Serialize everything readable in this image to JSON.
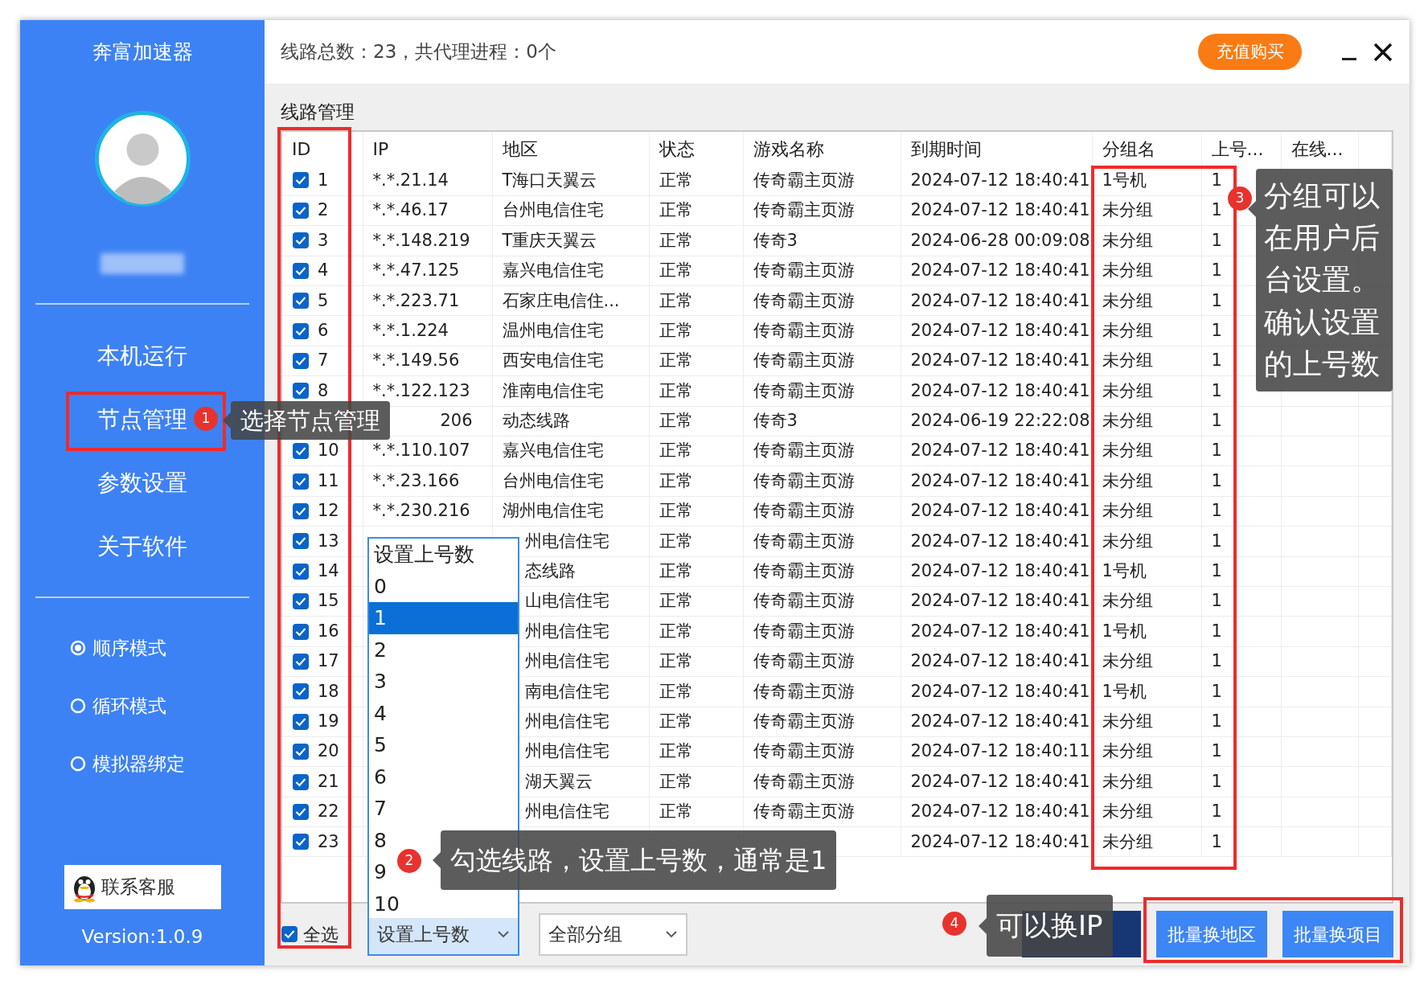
{
  "sidebar": {
    "title": "奔富加速器",
    "nav": [
      {
        "label": "本机运行"
      },
      {
        "label": "节点管理"
      },
      {
        "label": "参数设置"
      },
      {
        "label": "关于软件"
      }
    ],
    "modes": [
      {
        "label": "顺序模式",
        "checked": true
      },
      {
        "label": "循环模式",
        "checked": false
      },
      {
        "label": "模拟器绑定",
        "checked": false
      }
    ],
    "contact_button": "联系客服",
    "version": "Version:1.0.9"
  },
  "header": {
    "summary": "线路总数：23，共代理进程：0个",
    "recharge_button": "充值购买"
  },
  "section_title": "线路管理",
  "table": {
    "columns": [
      "ID",
      "IP",
      "地区",
      "状态",
      "游戏名称",
      "到期时间",
      "分组名",
      "上号...",
      "在线..."
    ],
    "rows": [
      {
        "checked": true,
        "id": "1",
        "ip": "*.*.21.14",
        "region": "T海口天翼云",
        "status": "正常",
        "game": "传奇霸主页游",
        "expires": "2024-07-12 18:40:41",
        "group": "1号机",
        "logins": "1"
      },
      {
        "checked": true,
        "id": "2",
        "ip": "*.*.46.17",
        "region": "台州电信住宅",
        "status": "正常",
        "game": "传奇霸主页游",
        "expires": "2024-07-12 18:40:41",
        "group": "未分组",
        "logins": "1"
      },
      {
        "checked": true,
        "id": "3",
        "ip": "*.*.148.219",
        "region": "T重庆天翼云",
        "status": "正常",
        "game": "传奇3",
        "expires": "2024-06-28 00:09:08",
        "group": "未分组",
        "logins": "1"
      },
      {
        "checked": true,
        "id": "4",
        "ip": "*.*.47.125",
        "region": "嘉兴电信住宅",
        "status": "正常",
        "game": "传奇霸主页游",
        "expires": "2024-07-12 18:40:41",
        "group": "未分组",
        "logins": "1"
      },
      {
        "checked": true,
        "id": "5",
        "ip": "*.*.223.71",
        "region": "石家庄电信住...",
        "status": "正常",
        "game": "传奇霸主页游",
        "expires": "2024-07-12 18:40:41",
        "group": "未分组",
        "logins": "1"
      },
      {
        "checked": true,
        "id": "6",
        "ip": "*.*.1.224",
        "region": "温州电信住宅",
        "status": "正常",
        "game": "传奇霸主页游",
        "expires": "2024-07-12 18:40:41",
        "group": "未分组",
        "logins": "1"
      },
      {
        "checked": true,
        "id": "7",
        "ip": "*.*.149.56",
        "region": "西安电信住宅",
        "status": "正常",
        "game": "传奇霸主页游",
        "expires": "2024-07-12 18:40:41",
        "group": "未分组",
        "logins": "1"
      },
      {
        "checked": true,
        "id": "8",
        "ip": "*.*.122.123",
        "region": "淮南电信住宅",
        "status": "正常",
        "game": "传奇霸主页游",
        "expires": "2024-07-12 18:40:41",
        "group": "未分组",
        "logins": "1"
      },
      {
        "ip": "206",
        "region": "动态线路",
        "status": "正常",
        "game": "传奇3",
        "expires": "2024-06-19 22:22:08",
        "group": "未分组",
        "logins": "1"
      },
      {
        "checked": true,
        "id": "10",
        "ip": "*.*.110.107",
        "region": "嘉兴电信住宅",
        "status": "正常",
        "game": "传奇霸主页游",
        "expires": "2024-07-12 18:40:41",
        "group": "未分组",
        "logins": "1"
      },
      {
        "checked": true,
        "id": "11",
        "ip": "*.*.23.166",
        "region": "台州电信住宅",
        "status": "正常",
        "game": "传奇霸主页游",
        "expires": "2024-07-12 18:40:41",
        "group": "未分组",
        "logins": "1"
      },
      {
        "checked": true,
        "id": "12",
        "ip": "*.*.230.216",
        "region": "湖州电信住宅",
        "status": "正常",
        "game": "传奇霸主页游",
        "expires": "2024-07-12 18:40:41",
        "group": "未分组",
        "logins": "1"
      },
      {
        "checked": true,
        "id": "13",
        "region": "州电信住宅",
        "status": "正常",
        "game": "传奇霸主页游",
        "expires": "2024-07-12 18:40:41",
        "group": "未分组",
        "logins": "1"
      },
      {
        "checked": true,
        "id": "14",
        "region": "态线路",
        "status": "正常",
        "game": "传奇霸主页游",
        "expires": "2024-07-12 18:40:41",
        "group": "1号机",
        "logins": "1"
      },
      {
        "checked": true,
        "id": "15",
        "region": "山电信住宅",
        "status": "正常",
        "game": "传奇霸主页游",
        "expires": "2024-07-12 18:40:41",
        "group": "未分组",
        "logins": "1"
      },
      {
        "checked": true,
        "id": "16",
        "region": "州电信住宅",
        "status": "正常",
        "game": "传奇霸主页游",
        "expires": "2024-07-12 18:40:41",
        "group": "1号机",
        "logins": "1"
      },
      {
        "checked": true,
        "id": "17",
        "region": "州电信住宅",
        "status": "正常",
        "game": "传奇霸主页游",
        "expires": "2024-07-12 18:40:41",
        "group": "未分组",
        "logins": "1"
      },
      {
        "checked": true,
        "id": "18",
        "region": "南电信住宅",
        "status": "正常",
        "game": "传奇霸主页游",
        "expires": "2024-07-12 18:40:41",
        "group": "1号机",
        "logins": "1"
      },
      {
        "checked": true,
        "id": "19",
        "region": "州电信住宅",
        "status": "正常",
        "game": "传奇霸主页游",
        "expires": "2024-07-12 18:40:41",
        "group": "未分组",
        "logins": "1"
      },
      {
        "checked": true,
        "id": "20",
        "region": "州电信住宅",
        "status": "正常",
        "game": "传奇霸主页游",
        "expires": "2024-07-12 18:40:11",
        "group": "未分组",
        "logins": "1"
      },
      {
        "checked": true,
        "id": "21",
        "region": "湖天翼云",
        "status": "正常",
        "game": "传奇霸主页游",
        "expires": "2024-07-12 18:40:41",
        "group": "未分组",
        "logins": "1"
      },
      {
        "checked": true,
        "id": "22",
        "region": "州电信住宅",
        "status": "正常",
        "game": "传奇霸主页游",
        "expires": "2024-07-12 18:40:41",
        "group": "未分组",
        "logins": "1"
      },
      {
        "checked": true,
        "id": "23",
        "expires": "2024-07-12 18:40:41",
        "group": "未分组",
        "logins": "1"
      }
    ]
  },
  "dropdown_list": {
    "options": [
      {
        "label": "设置上号数",
        "selected": false
      },
      {
        "label": "0",
        "selected": false
      },
      {
        "label": "1",
        "selected": true
      },
      {
        "label": "2",
        "selected": false
      },
      {
        "label": "3",
        "selected": false
      },
      {
        "label": "4",
        "selected": false
      },
      {
        "label": "5",
        "selected": false
      },
      {
        "label": "6",
        "selected": false
      },
      {
        "label": "7",
        "selected": false
      },
      {
        "label": "8",
        "selected": false
      },
      {
        "label": "9",
        "selected": false
      },
      {
        "label": "10",
        "selected": false
      }
    ]
  },
  "bottom_bar": {
    "select_all": {
      "label": "全选",
      "checked": true
    },
    "logins_select": "设置上号数",
    "group_select": "全部分组",
    "buttons": [
      "批量换地区",
      "批量换项目"
    ]
  },
  "annotations": [
    {
      "number": "1",
      "text": "选择节点管理"
    },
    {
      "number": "2",
      "text": "勾选线路，设置上号数，通常是1"
    },
    {
      "number": "3",
      "text": "分组可以在用户后台设置。确认设置的上号数"
    },
    {
      "number": "4",
      "text": "可以换IP"
    }
  ]
}
